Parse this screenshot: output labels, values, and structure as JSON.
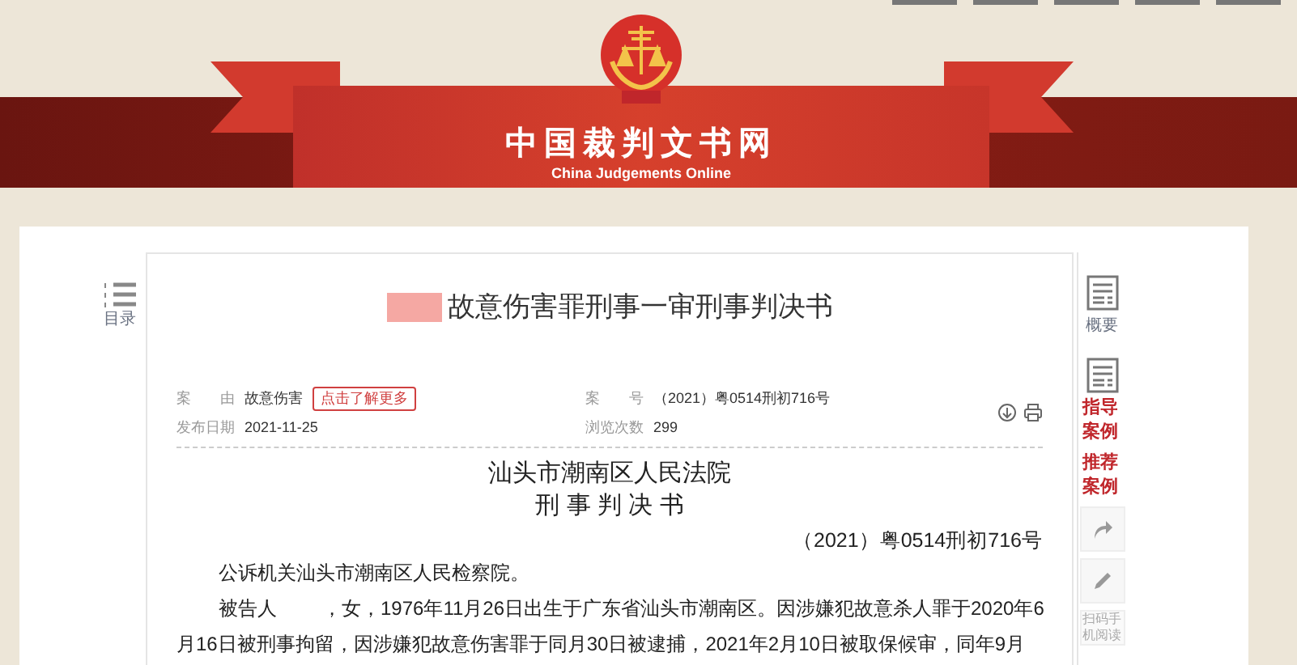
{
  "header": {
    "site_title": "中国裁判文书网",
    "site_subtitle": "China Judgements Online"
  },
  "left_tools": [
    {
      "label": "目录"
    }
  ],
  "document": {
    "title": "故意伤害罪刑事一审刑事判决书",
    "title_redacted": true,
    "meta": [
      {
        "label": "案　　由",
        "value": "故意伤害",
        "link": "点击了解更多"
      },
      {
        "label": "案　　号",
        "value": "（2021）粤0514刑初716号"
      },
      {
        "label": "发布日期",
        "value": "2021-11-25"
      },
      {
        "label": "浏览次数",
        "value": "299"
      }
    ],
    "court": "汕头市潮南区人民法院",
    "doc_type": "刑 事 判 决 书",
    "case_number": "（2021）粤0514刑初716号",
    "paragraphs": [
      {
        "before": "公诉机关汕头市潮南区人民检察院。"
      },
      {
        "before": "被告人",
        "after": "，女，1976年11月26日出生于广东省汕头市潮南区。因涉嫌犯故意杀人罪于2020年6月16日被刑事拘留，因涉嫌犯故意伤害罪于同月30日被逮捕，2021年2月10日被取保候审，同年9月"
      }
    ]
  },
  "right_tools": [
    {
      "kind": "doc",
      "label": "概要"
    },
    {
      "kind": "doc-red",
      "label": "指导案例"
    },
    {
      "kind": "red",
      "label": "推荐案例"
    },
    {
      "kind": "share"
    },
    {
      "kind": "edit"
    },
    {
      "kind": "text",
      "label": "扫码手机阅读"
    }
  ]
}
